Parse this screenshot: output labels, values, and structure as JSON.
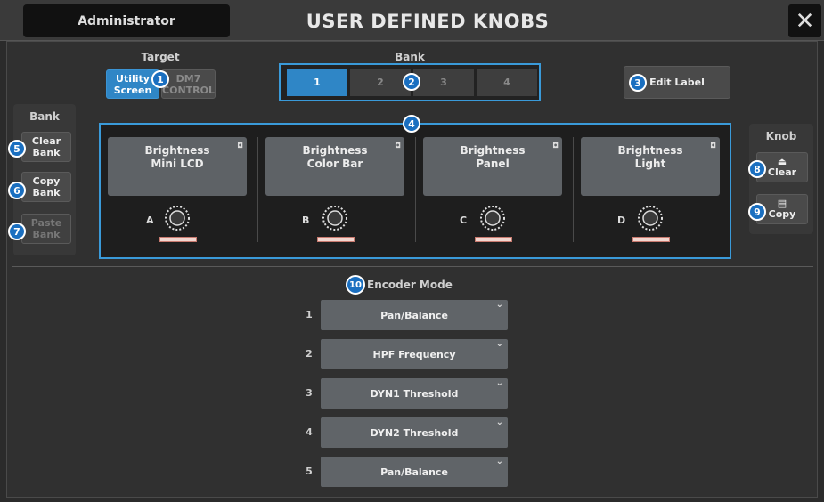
{
  "header": {
    "user_label": "Administrator",
    "title": "USER DEFINED KNOBS",
    "close_symbol": "✕"
  },
  "target": {
    "label": "Target",
    "options": [
      "Utility\nScreen",
      "DM7\nCONTROL"
    ],
    "selected_index": 0
  },
  "bank": {
    "label": "Bank",
    "tabs": [
      "1",
      "2",
      "3",
      "4"
    ],
    "selected_index": 0
  },
  "edit_label_button": "Edit Label",
  "left_panel": {
    "label": "Bank",
    "clear": "Clear\nBank",
    "copy": "Copy\nBank",
    "paste": "Paste\nBank"
  },
  "right_panel": {
    "label": "Knob",
    "clear": "Clear",
    "copy": "Copy"
  },
  "knobs": [
    {
      "letter": "A",
      "name": "Brightness\nMini LCD"
    },
    {
      "letter": "B",
      "name": "Brightness\nColor Bar"
    },
    {
      "letter": "C",
      "name": "Brightness\nPanel"
    },
    {
      "letter": "D",
      "name": "Brightness\nLight"
    }
  ],
  "encoder_mode": {
    "label": "Encoder Mode",
    "rows": [
      {
        "num": "1",
        "value": "Pan/Balance"
      },
      {
        "num": "2",
        "value": "HPF Frequency"
      },
      {
        "num": "3",
        "value": "DYN1 Threshold"
      },
      {
        "num": "4",
        "value": "DYN2 Threshold"
      },
      {
        "num": "5",
        "value": "Pan/Balance"
      }
    ]
  },
  "callouts": [
    "1",
    "2",
    "3",
    "4",
    "5",
    "6",
    "7",
    "8",
    "9",
    "10"
  ],
  "colors": {
    "accent": "#2f86c6",
    "callout": "#1a6fc0",
    "highlight_border": "#3a9ad9"
  }
}
